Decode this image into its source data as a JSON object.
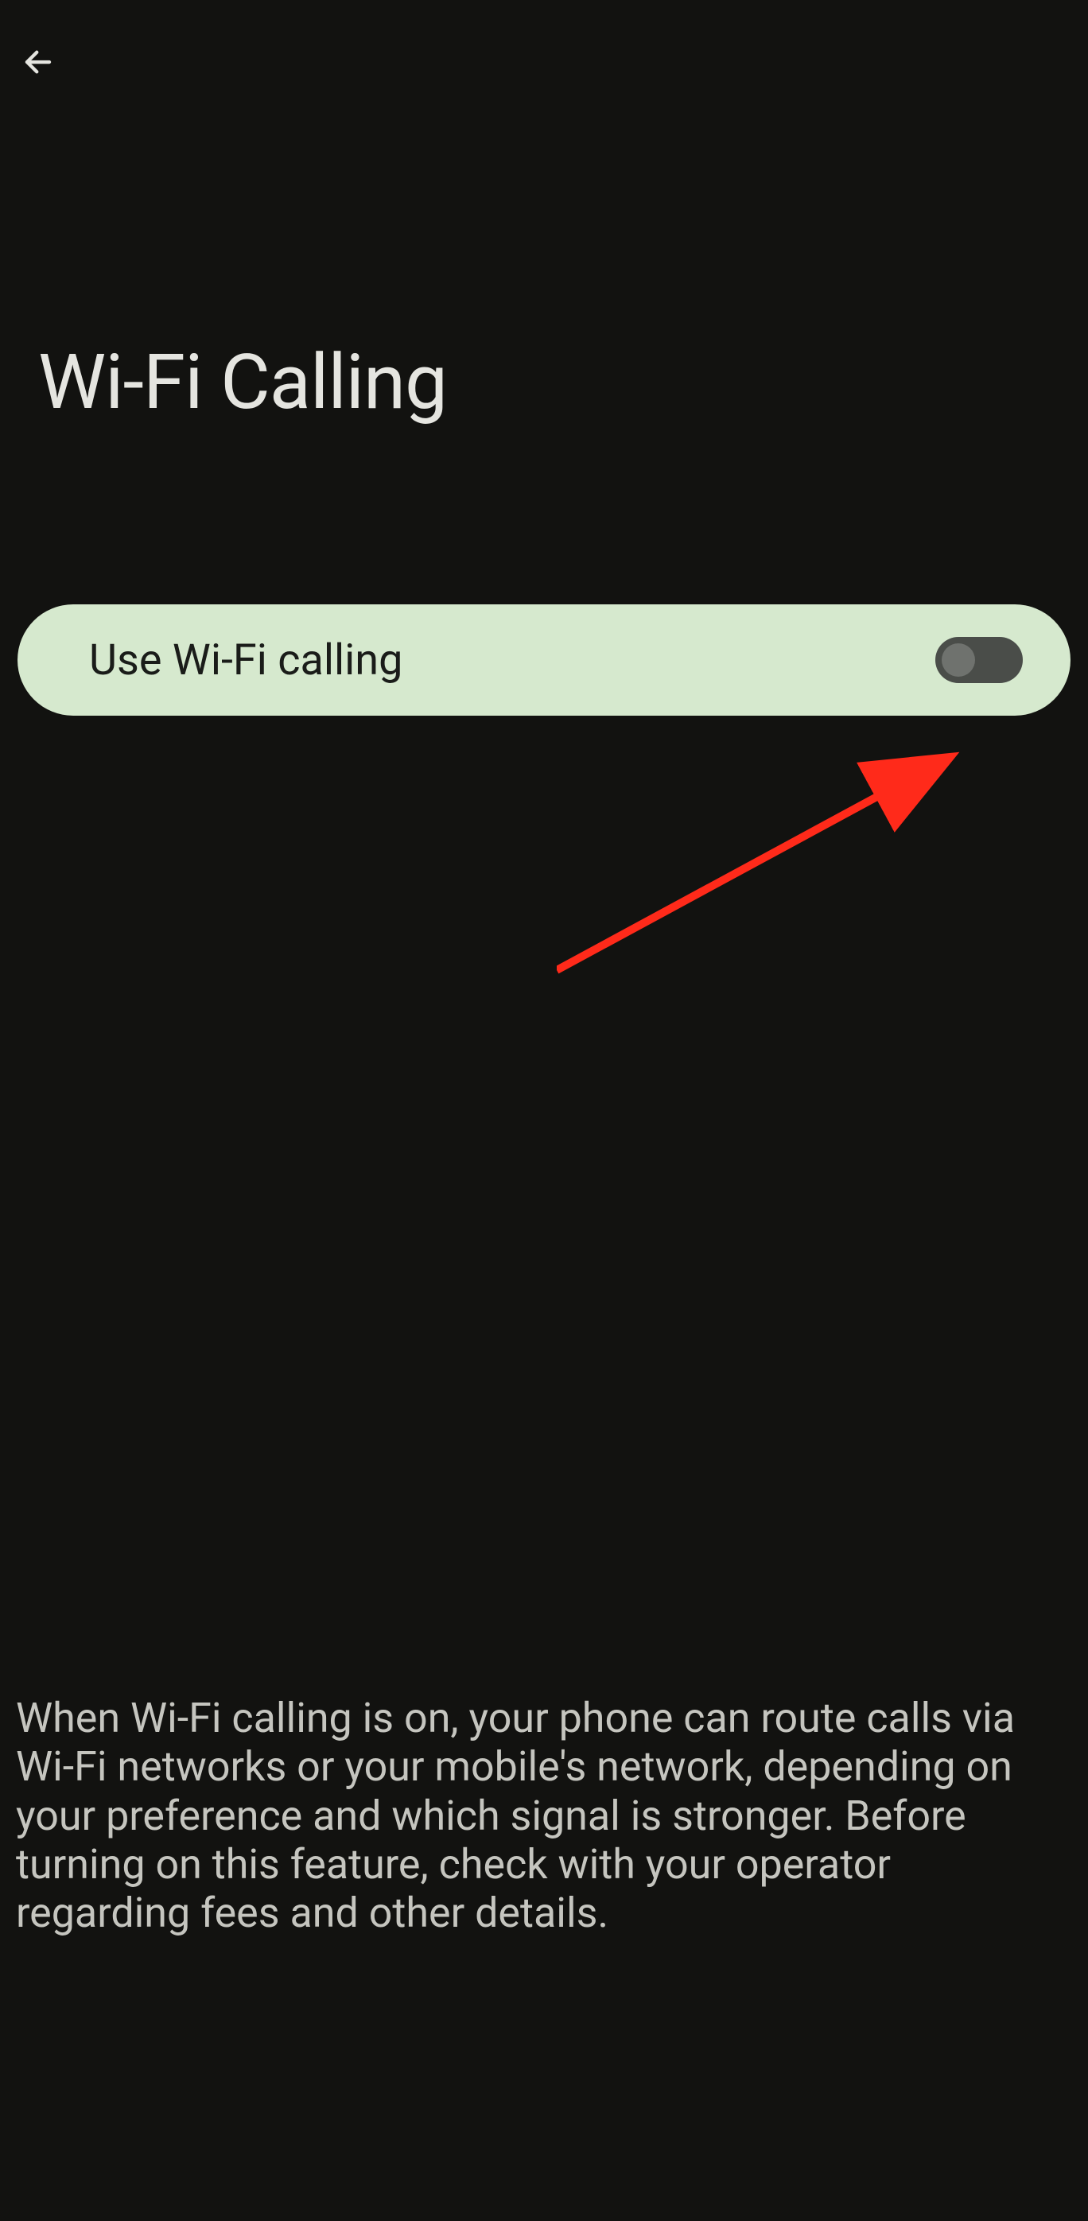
{
  "page": {
    "title": "Wi-Fi Calling"
  },
  "toggle": {
    "label": "Use Wi-Fi calling",
    "state": "off"
  },
  "description": {
    "text": "When Wi-Fi calling is on, your phone can route calls via Wi-Fi networks or your mobile's network, depending on your preference and which signal is stronger. Before turning on this feature, check with your operator regarding fees and other details."
  }
}
